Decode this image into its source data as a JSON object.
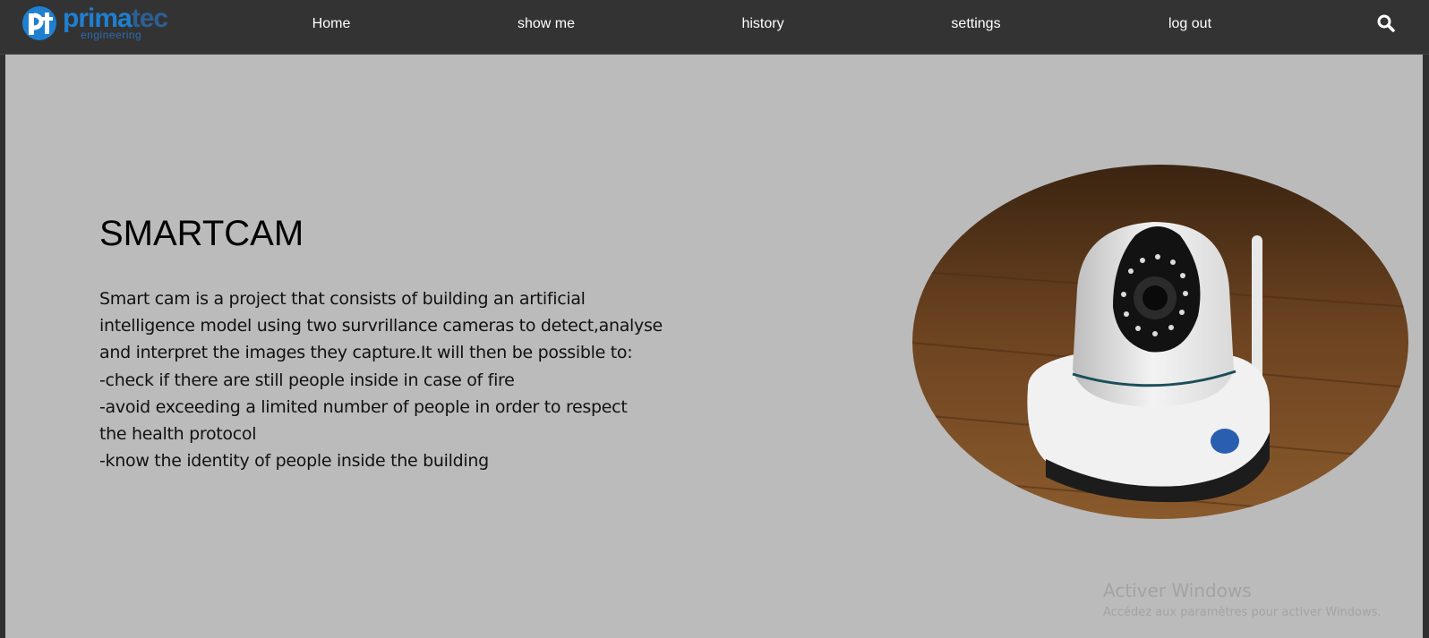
{
  "brand": {
    "logo_text_main": "prima",
    "logo_text_faded": "tec",
    "logo_subtext": "engineering"
  },
  "nav": {
    "items": [
      {
        "label": "Home"
      },
      {
        "label": "show me"
      },
      {
        "label": "history"
      },
      {
        "label": "settings"
      },
      {
        "label": "log out"
      }
    ],
    "search_icon": "search-icon"
  },
  "main": {
    "title": "SMARTCAM",
    "description_lines": [
      "Smart cam is a project that consists of building an artificial",
      "intelligence model using two survrillance cameras to detect,analyse",
      "and interpret the images they capture.It will then be possible to:",
      "-check if there are still people inside in case of fire",
      "-avoid exceeding a limited number of people in order to respect",
      "the health protocol",
      "-know the identity of people inside the building"
    ]
  },
  "watermark": {
    "title": "Activer Windows",
    "subtitle": "Accédez aux paramètres pour activer Windows."
  },
  "colors": {
    "page_background": "#bbbbbb",
    "topbar_background": "#333333",
    "brand_blue": "#1f7fd1"
  }
}
